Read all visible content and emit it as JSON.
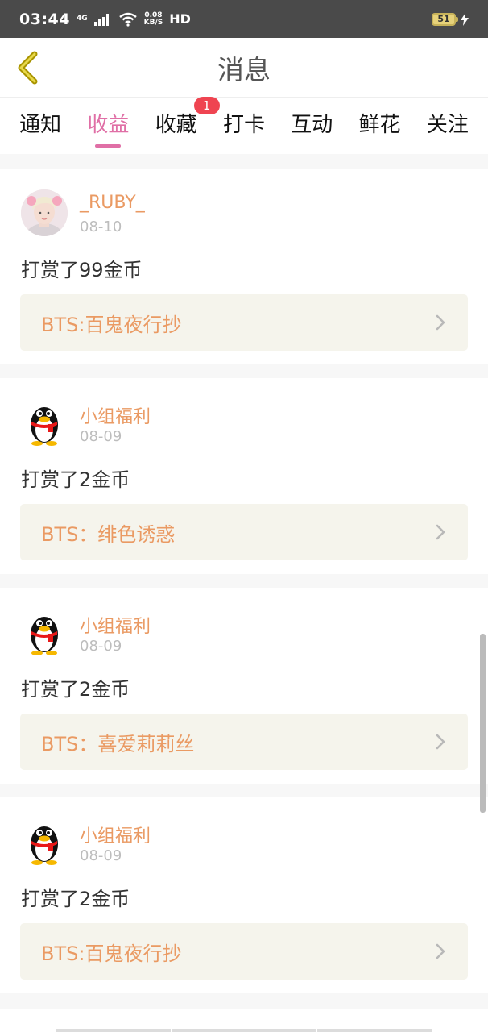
{
  "status_bar": {
    "time": "03:44",
    "network": "4G",
    "speed_value": "0.08",
    "speed_unit": "KB/S",
    "hd": "HD",
    "battery": "51"
  },
  "header": {
    "title": "消息"
  },
  "tabs": [
    {
      "label": "通知",
      "active": false
    },
    {
      "label": "收益",
      "active": true
    },
    {
      "label": "收藏",
      "active": false,
      "badge": "1"
    },
    {
      "label": "打卡",
      "active": false
    },
    {
      "label": "互动",
      "active": false
    },
    {
      "label": "鲜花",
      "active": false
    },
    {
      "label": "关注",
      "active": false
    }
  ],
  "messages": [
    {
      "user": "_RUBY_",
      "avatar": "photo-avatar",
      "date": "08-10",
      "text": "打赏了99金币",
      "link": "BTS:百鬼夜行抄"
    },
    {
      "user": "小组福利",
      "avatar": "penguin-icon",
      "date": "08-09",
      "text": "打赏了2金币",
      "link": "BTS：绯色诱惑"
    },
    {
      "user": "小组福利",
      "avatar": "penguin-icon",
      "date": "08-09",
      "text": "打赏了2金币",
      "link": "BTS：喜爱莉莉丝"
    },
    {
      "user": "小组福利",
      "avatar": "penguin-icon",
      "date": "08-09",
      "text": "打赏了2金币",
      "link": "BTS:百鬼夜行抄"
    }
  ],
  "colors": {
    "accent": "#e06fa6",
    "username": "#ea9a63",
    "badge": "#ef4451",
    "link_bg": "#f5f4ec"
  }
}
